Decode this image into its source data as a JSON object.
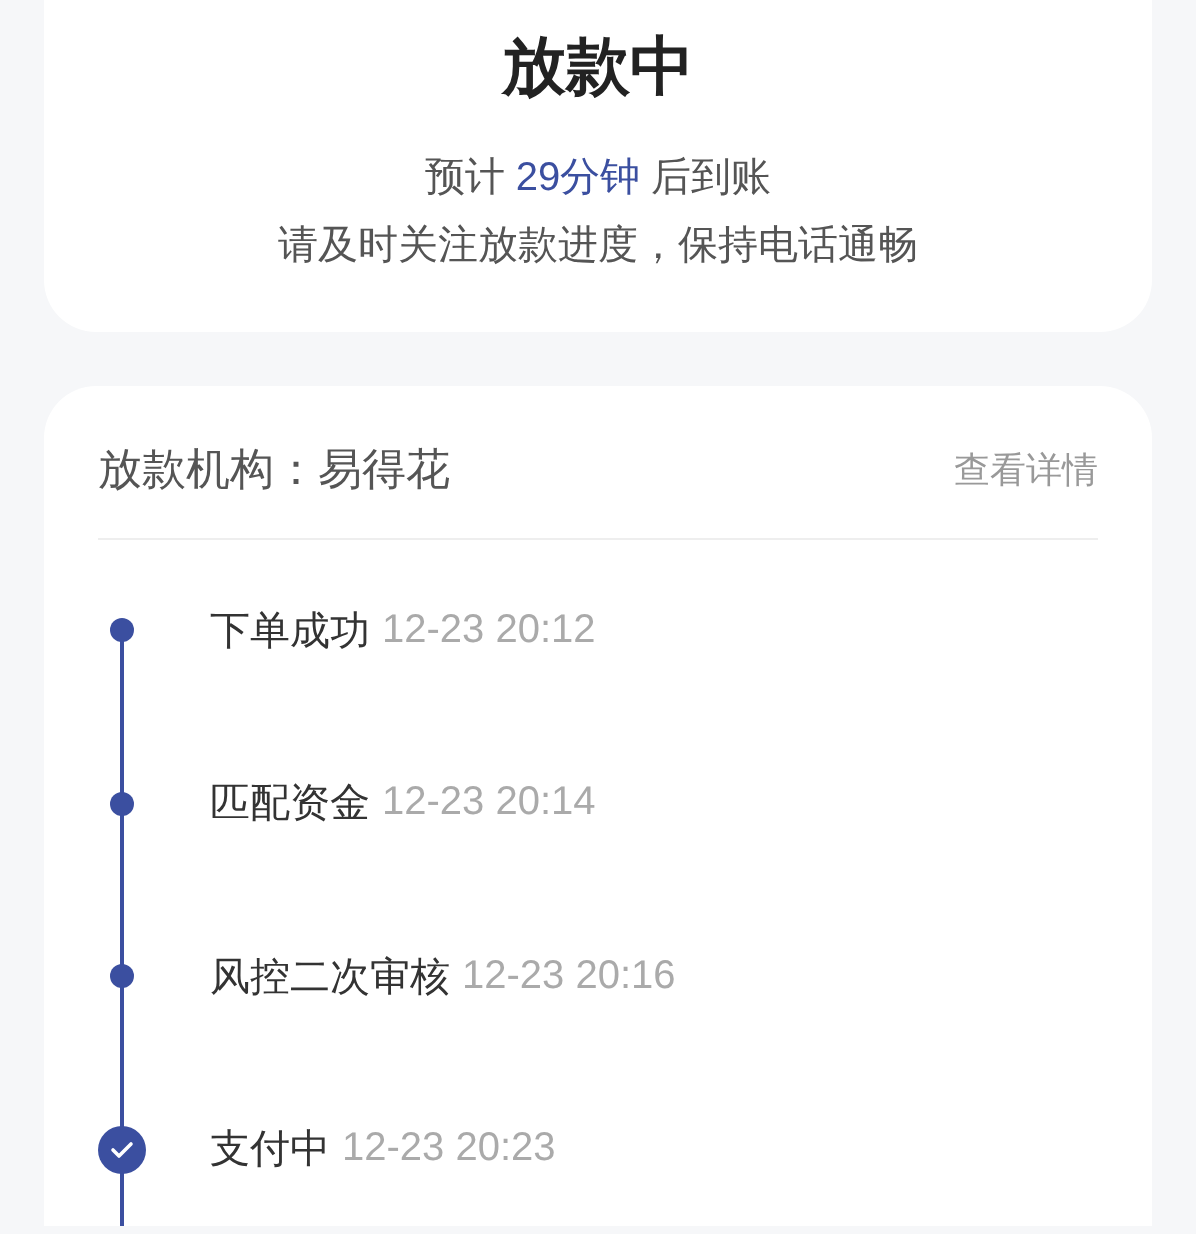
{
  "status": {
    "title": "放款中",
    "eta": {
      "prefix": "预计",
      "value": "29分钟",
      "suffix": "后到账"
    },
    "notice": "请及时关注放款进度，保持电话通畅"
  },
  "lender": {
    "label": "放款机构：易得花",
    "details_link": "查看详情"
  },
  "timeline": [
    {
      "title": "下单成功",
      "time": "12-23 20:12",
      "current": false
    },
    {
      "title": "匹配资金",
      "time": "12-23 20:14",
      "current": false
    },
    {
      "title": "风控二次审核",
      "time": "12-23 20:16",
      "current": false
    },
    {
      "title": "支付中",
      "time": "12-23 20:23",
      "current": true
    }
  ]
}
